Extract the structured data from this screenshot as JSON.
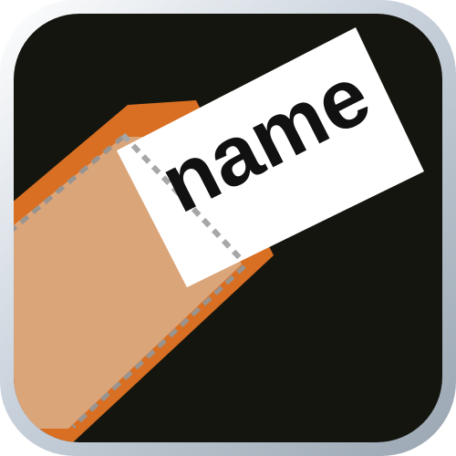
{
  "app_icon": {
    "label": "name",
    "colors": {
      "frame_light": "#ffffff",
      "frame_mid": "#c9d2dc",
      "frame_dark": "#9aa6b2",
      "background": "#15150f",
      "luggage_outer": "#d86f22",
      "luggage_inner": "#dba57a",
      "stitch": "#9a9490",
      "tag_white": "#ffffff",
      "tag_fold": "#e8e8e8",
      "tag_dashes": "#a7a7a7",
      "text": "#111111"
    }
  }
}
